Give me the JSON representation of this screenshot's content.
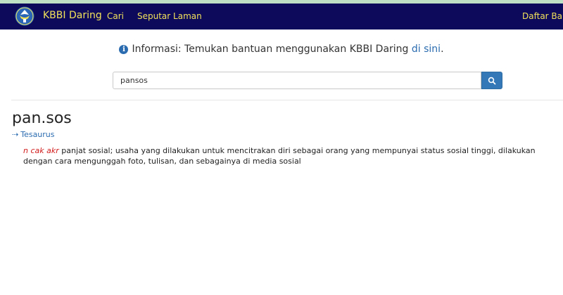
{
  "navbar": {
    "brand": "KBBI Daring",
    "links": [
      "Cari",
      "Seputar Laman",
      "Daftar Baru"
    ],
    "logo_icon": "tut-wuri-handayani-logo",
    "background_color": "#0d0a5c",
    "text_color": "#f1e15a"
  },
  "info": {
    "icon": "info-circle-icon",
    "text": "Informasi: Temukan bantuan menggunakan KBBI Daring ",
    "link_text": "di sini",
    "suffix": "."
  },
  "search": {
    "value": "pansos",
    "button_icon": "search-icon",
    "button_color": "#3478b8"
  },
  "entry": {
    "headword": "pan.sos",
    "thesaurus_arrow": "⇢",
    "thesaurus_label": "Tesaurus",
    "tags": "n cak akr",
    "definition": "panjat sosial; usaha yang dilakukan untuk mencitrakan diri sebagai orang yang mempunyai status sosial tinggi, dilakukan dengan cara mengunggah foto, tulisan, dan sebagainya di media sosial"
  }
}
